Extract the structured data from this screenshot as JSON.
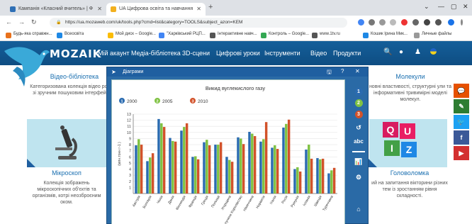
{
  "browser": {
    "tabs": [
      {
        "title": "Кампанія «Класний вчитель» | Ф",
        "active": false
      },
      {
        "title": "UA Цифрова освіта та навчання",
        "active": true
      }
    ],
    "new_tab": "+",
    "window_controls": [
      "⌄",
      "—",
      "▢",
      "✕"
    ],
    "nav_buttons": [
      "←",
      "→",
      "↻"
    ],
    "url": "https://ua.mozaweb.com/uk/tools.php?cmd=list&category=TOOLS&subject_azon=KEM",
    "bookmarks": [
      {
        "label": "Будь-яка справжн...",
        "color": "#e8711c"
      },
      {
        "label": "Всеосвіта",
        "color": "#1e88e5"
      },
      {
        "label": "Мой диск – Google...",
        "color": "#fbbc04"
      },
      {
        "label": "\"Харківський РЦП...",
        "color": "#4285f4"
      },
      {
        "label": "Інтерактивне навч...",
        "color": "#555555"
      },
      {
        "label": "Контроль – Google...",
        "color": "#34a853"
      },
      {
        "label": "www.1tv.ru",
        "color": "#555555"
      },
      {
        "label": "Кошик Ірина Мик...",
        "color": "#1e88e5"
      },
      {
        "label": "Личные файлы",
        "color": "#999999"
      }
    ]
  },
  "site": {
    "logo": "MOZAIK",
    "menu": [
      "Мій акаунт",
      "Медіа-бібліотека",
      "3D-сцени",
      "Цифрові уроки",
      "Інструменти",
      "Відео",
      "Продукти"
    ],
    "cards": {
      "video_library": {
        "title": "Відео-бібліотека",
        "text": "Категоризована колекція відео роликів зі зручним пошуковим інтерфейсом."
      },
      "molecules": {
        "title": "Молекули",
        "text": "новні властивості, структурні ули та інформативні тривимірні моделі молекул."
      },
      "microscope": {
        "title": "Мікроскоп",
        "text": "Колекція зображень мікроскопічних об'єктів та організмів, котрі неозброєним оком."
      },
      "puzzle": {
        "title": "Головоломка",
        "text": "ий на запитання вікторини різних тем із зростанням рівня складності."
      }
    },
    "quiz_letters": [
      "Q",
      "U",
      "I",
      "Z"
    ],
    "side_buttons": [
      "💬",
      "✎",
      "🐦",
      "f",
      "▶"
    ]
  },
  "dialog": {
    "title": "Діаграми",
    "buttons": [
      "🖫",
      "?",
      "✕"
    ],
    "tool_labels": [
      "1",
      "2",
      "3",
      "↺",
      "abc",
      "📊",
      "⚙",
      "⌂"
    ]
  },
  "chart_data": {
    "type": "bar",
    "title": "Викид вуглекислого газу",
    "ylabel": "(млн.тонн г-1 )",
    "ylim": [
      0,
      13
    ],
    "yticks": [
      1,
      2,
      3,
      4,
      5,
      6,
      7,
      8,
      9,
      10,
      11,
      12,
      13
    ],
    "categories": [
      "Австрія",
      "Болгарія",
      "Чехія",
      "Данія",
      "Фінляндія",
      "Франція",
      "Греція",
      "Польща",
      "Угорщина",
      "Сполучене Королівство",
      "Німеччина",
      "Норвегія",
      "Італія",
      "Росія",
      "Румунія",
      "Іспанія",
      "Швеція",
      "Туреччина"
    ],
    "series": [
      {
        "name": "2000",
        "color": "#2a6bb0",
        "values": [
          7.9,
          5.3,
          12.2,
          9.1,
          10.3,
          6.0,
          8.4,
          8.0,
          6.0,
          9.2,
          10.1,
          8.5,
          7.5,
          10.8,
          4.0,
          7.2,
          5.8,
          3.3
        ]
      },
      {
        "name": "2005",
        "color": "#7fc242",
        "values": [
          8.9,
          5.9,
          11.5,
          8.6,
          10.9,
          6.1,
          8.8,
          8.0,
          5.5,
          9.0,
          9.8,
          8.9,
          7.9,
          11.4,
          4.3,
          8.0,
          5.6,
          3.8
        ]
      },
      {
        "name": "2010",
        "color": "#d2522a",
        "values": [
          8.0,
          6.6,
          10.9,
          8.5,
          11.5,
          5.6,
          7.9,
          8.4,
          5.2,
          8.1,
          9.4,
          11.7,
          7.3,
          12.1,
          3.6,
          5.7,
          5.7,
          4.2
        ]
      }
    ]
  }
}
